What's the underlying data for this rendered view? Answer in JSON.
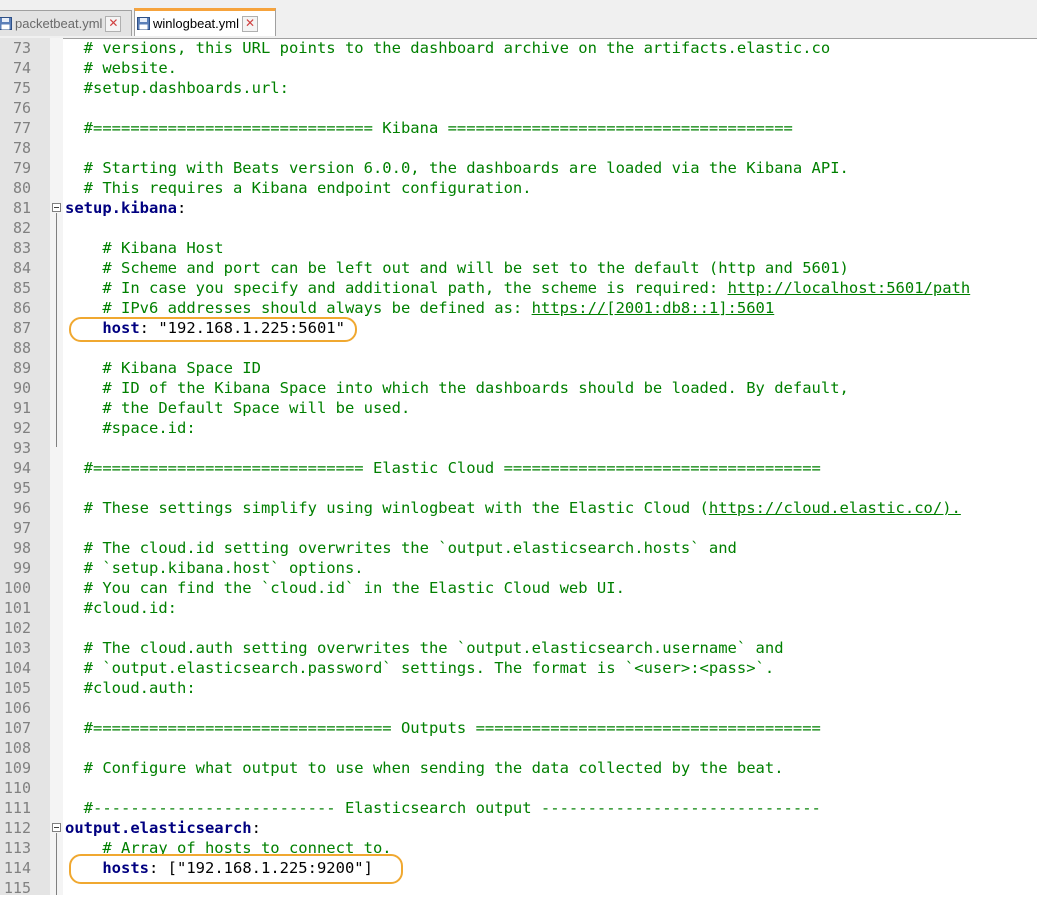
{
  "tabs": [
    {
      "label": "packetbeat.yml",
      "active": false
    },
    {
      "label": "winlogbeat.yml",
      "active": true
    }
  ],
  "close_glyph": "✕",
  "lines": [
    {
      "n": "73",
      "parts": [
        {
          "t": "  # versions, this URL points to the dashboard archive on the artifacts.elastic.co",
          "c": "c"
        }
      ]
    },
    {
      "n": "74",
      "parts": [
        {
          "t": "  # website.",
          "c": "c"
        }
      ]
    },
    {
      "n": "75",
      "parts": [
        {
          "t": "  #setup.dashboards.url:",
          "c": "c"
        }
      ]
    },
    {
      "n": "76",
      "parts": []
    },
    {
      "n": "77",
      "parts": [
        {
          "t": "  #============================== Kibana =====================================",
          "c": "c"
        }
      ]
    },
    {
      "n": "78",
      "parts": []
    },
    {
      "n": "79",
      "parts": [
        {
          "t": "  # Starting with Beats version 6.0.0, the dashboards are loaded via the Kibana API.",
          "c": "c"
        }
      ]
    },
    {
      "n": "80",
      "parts": [
        {
          "t": "  # This requires a Kibana endpoint configuration.",
          "c": "c"
        }
      ]
    },
    {
      "n": "81",
      "parts": [
        {
          "t": "setup.kibana",
          "c": "k"
        },
        {
          "t": ":",
          "c": "s"
        }
      ]
    },
    {
      "n": "82",
      "parts": []
    },
    {
      "n": "83",
      "parts": [
        {
          "t": "    # Kibana Host",
          "c": "c"
        }
      ]
    },
    {
      "n": "84",
      "parts": [
        {
          "t": "    # Scheme and port can be left out and will be set to the default (http and 5601)",
          "c": "c"
        }
      ]
    },
    {
      "n": "85",
      "parts": [
        {
          "t": "    # In case you specify and additional path, the scheme is required: ",
          "c": "c"
        },
        {
          "t": "http://localhost:5601/path",
          "c": "u"
        }
      ]
    },
    {
      "n": "86",
      "parts": [
        {
          "t": "    # IPv6 addresses should always be defined as: ",
          "c": "c"
        },
        {
          "t": "https://[2001:db8::1]:5601",
          "c": "u"
        }
      ]
    },
    {
      "n": "87",
      "parts": [
        {
          "t": "    ",
          "c": "s"
        },
        {
          "t": "host",
          "c": "k"
        },
        {
          "t": ": \"192.168.1.225:5601\"",
          "c": "s"
        }
      ]
    },
    {
      "n": "88",
      "parts": []
    },
    {
      "n": "89",
      "parts": [
        {
          "t": "    # Kibana Space ID",
          "c": "c"
        }
      ]
    },
    {
      "n": "90",
      "parts": [
        {
          "t": "    # ID of the Kibana Space into which the dashboards should be loaded. By default,",
          "c": "c"
        }
      ]
    },
    {
      "n": "91",
      "parts": [
        {
          "t": "    # the Default Space will be used.",
          "c": "c"
        }
      ]
    },
    {
      "n": "92",
      "parts": [
        {
          "t": "    #space.id:",
          "c": "c"
        }
      ]
    },
    {
      "n": "93",
      "parts": []
    },
    {
      "n": "94",
      "parts": [
        {
          "t": "  #============================= Elastic Cloud ==================================",
          "c": "c"
        }
      ]
    },
    {
      "n": "95",
      "parts": []
    },
    {
      "n": "96",
      "parts": [
        {
          "t": "  # These settings simplify using winlogbeat with the Elastic Cloud (",
          "c": "c"
        },
        {
          "t": "https://cloud.elastic.co/).",
          "c": "u"
        }
      ]
    },
    {
      "n": "97",
      "parts": []
    },
    {
      "n": "98",
      "parts": [
        {
          "t": "  # The cloud.id setting overwrites the `output.elasticsearch.hosts` and",
          "c": "c"
        }
      ]
    },
    {
      "n": "99",
      "parts": [
        {
          "t": "  # `setup.kibana.host` options.",
          "c": "c"
        }
      ]
    },
    {
      "n": "100",
      "parts": [
        {
          "t": "  # You can find the `cloud.id` in the Elastic Cloud web UI.",
          "c": "c"
        }
      ]
    },
    {
      "n": "101",
      "parts": [
        {
          "t": "  #cloud.id:",
          "c": "c"
        }
      ]
    },
    {
      "n": "102",
      "parts": []
    },
    {
      "n": "103",
      "parts": [
        {
          "t": "  # The cloud.auth setting overwrites the `output.elasticsearch.username` and",
          "c": "c"
        }
      ]
    },
    {
      "n": "104",
      "parts": [
        {
          "t": "  # `output.elasticsearch.password` settings. The format is `<user>:<pass>`.",
          "c": "c"
        }
      ]
    },
    {
      "n": "105",
      "parts": [
        {
          "t": "  #cloud.auth:",
          "c": "c"
        }
      ]
    },
    {
      "n": "106",
      "parts": []
    },
    {
      "n": "107",
      "parts": [
        {
          "t": "  #================================ Outputs =====================================",
          "c": "c"
        }
      ]
    },
    {
      "n": "108",
      "parts": []
    },
    {
      "n": "109",
      "parts": [
        {
          "t": "  # Configure what output to use when sending the data collected by the beat.",
          "c": "c"
        }
      ]
    },
    {
      "n": "110",
      "parts": []
    },
    {
      "n": "111",
      "parts": [
        {
          "t": "  #-------------------------- Elasticsearch output ------------------------------",
          "c": "c"
        }
      ]
    },
    {
      "n": "112",
      "parts": [
        {
          "t": "output.elasticsearch",
          "c": "k"
        },
        {
          "t": ":",
          "c": "s"
        }
      ]
    },
    {
      "n": "113",
      "parts": [
        {
          "t": "    # Array of hosts to connect to.",
          "c": "c"
        }
      ]
    },
    {
      "n": "114",
      "parts": [
        {
          "t": "    ",
          "c": "s"
        },
        {
          "t": "hosts",
          "c": "k"
        },
        {
          "t": ": [\"192.168.1.225:9200\"]",
          "c": "s"
        }
      ]
    },
    {
      "n": "115",
      "parts": []
    }
  ]
}
